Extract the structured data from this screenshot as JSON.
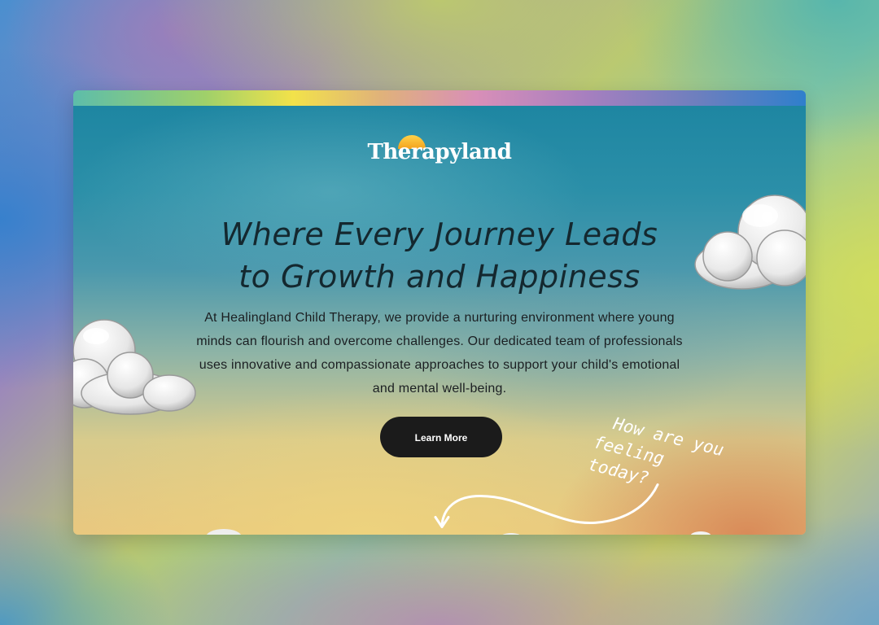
{
  "brand": {
    "name": "Therapyland",
    "sun_color": "#f7b733"
  },
  "hero": {
    "headline_line1": "Where Every Journey Leads",
    "headline_line2": "to Growth and Happiness",
    "body": "At Healingland Child Therapy, we provide a nurturing environment where young minds can flourish and overcome challenges. Our dedicated team of professionals uses innovative and compassionate approaches to support your child's emotional and mental well-being.",
    "cta_label": "Learn More",
    "note_line1": "How are you",
    "note_line2": "feeling today?"
  },
  "icons": [
    "cloud-icon",
    "curved-arrow-icon",
    "sun-icon"
  ],
  "colors": {
    "cta_background": "#1b1b1b",
    "headline": "#14282f",
    "sky_top": "#1e86a2",
    "sky_bottom": "#e9c77f"
  }
}
